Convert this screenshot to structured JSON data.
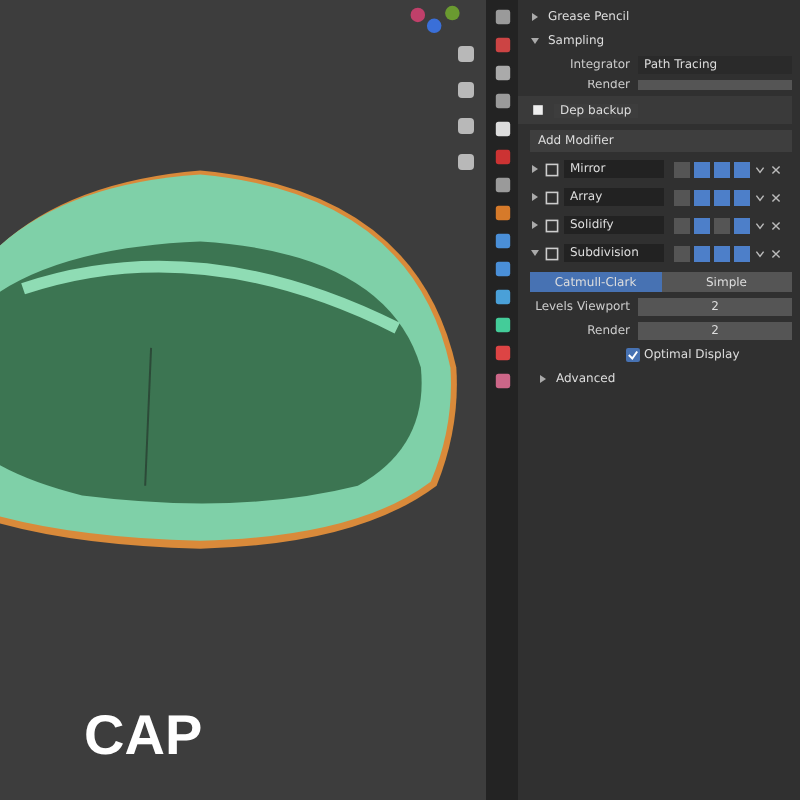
{
  "viewport": {
    "caption": "CAP"
  },
  "sections": [
    {
      "label": "Grease Pencil",
      "expanded": false
    },
    {
      "label": "Sampling",
      "expanded": true
    }
  ],
  "sampling": {
    "integrator_label": "Integrator",
    "integrator_value": "Path Tracing",
    "render_label": "Render"
  },
  "object": {
    "name": "Dep backup"
  },
  "add_modifier": "Add Modifier",
  "modifiers": [
    {
      "name": "Mirror",
      "expanded": false,
      "toggles": [
        {
          "on": false
        },
        {
          "on": true
        },
        {
          "on": true
        },
        {
          "on": true
        }
      ]
    },
    {
      "name": "Array",
      "expanded": false,
      "toggles": [
        {
          "on": false
        },
        {
          "on": true
        },
        {
          "on": true
        },
        {
          "on": true
        }
      ]
    },
    {
      "name": "Solidify",
      "expanded": false,
      "toggles": [
        {
          "on": false
        },
        {
          "on": true
        },
        {
          "on": false
        },
        {
          "on": true
        }
      ]
    },
    {
      "name": "Subdivision",
      "expanded": true,
      "toggles": [
        {
          "on": false
        },
        {
          "on": true
        },
        {
          "on": true
        },
        {
          "on": true
        }
      ]
    }
  ],
  "subdiv_tabs": [
    {
      "label": "Catmull-Clark",
      "selected": true
    },
    {
      "label": "Simple",
      "selected": false
    }
  ],
  "levels": [
    {
      "label": "Levels Viewport",
      "value": "2"
    },
    {
      "label": "Render",
      "value": "2"
    }
  ],
  "optimal_display": {
    "label": "Optimal Display",
    "checked": true
  },
  "advanced": {
    "label": "Advanced",
    "expanded": false
  }
}
